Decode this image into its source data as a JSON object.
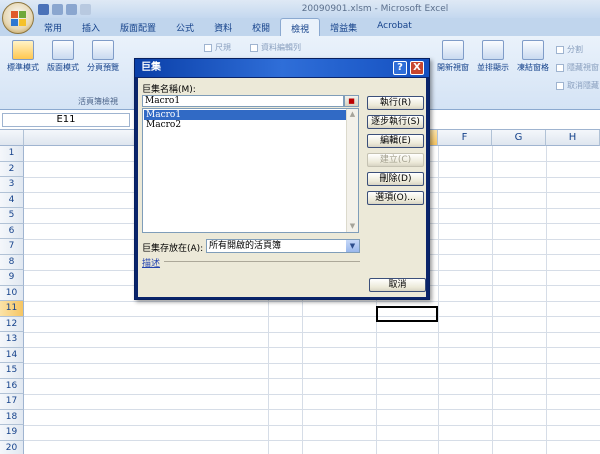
{
  "window": {
    "title": "20090901.xlsm - Microsoft Excel"
  },
  "ribbon_tabs": [
    "常用",
    "插入",
    "版面配置",
    "公式",
    "資料",
    "校閱",
    "檢視",
    "增益集",
    "Acrobat"
  ],
  "active_tab_index": 6,
  "ribbon": {
    "btn_normal": "標準模式",
    "btn_page_layout": "版面模式",
    "btn_page_break": "分頁預覽",
    "group_workbook_views": "活頁簿檢視",
    "check_ruler": "尺規",
    "check_formula_bar": "資料編輯列",
    "btn_new_window": "開新視窗",
    "btn_arrange": "並排顯示",
    "btn_freeze": "凍結窗格",
    "split": "分割",
    "hide": "隱藏視窗",
    "unhide": "取消隱藏"
  },
  "name_box": "E11",
  "columns": [
    "F",
    "G",
    "H"
  ],
  "rows": [
    "1",
    "2",
    "3",
    "4",
    "5",
    "6",
    "7",
    "8",
    "9",
    "10",
    "11",
    "12",
    "13",
    "14",
    "15",
    "16",
    "17",
    "18",
    "19",
    "20"
  ],
  "selected_row": "11",
  "dialog": {
    "title": "巨集",
    "help_glyph": "?",
    "close_glyph": "X",
    "macro_name_label": "巨集名稱(M):",
    "macro_name_value": "Macro1",
    "macros": [
      "Macro1",
      "Macro2"
    ],
    "selected_index": 0,
    "buttons": {
      "run": "執行(R)",
      "step_into": "逐步執行(S)",
      "edit": "編輯(E)",
      "create": "建立(C)",
      "delete": "刪除(D)",
      "options": "選項(O)...",
      "cancel": "取消"
    },
    "macros_in_label": "巨集存放在(A):",
    "macros_in_value": "所有開啟的活頁簿",
    "description_label": "描述"
  },
  "colors": {
    "title_gradient": "#0a3fa8",
    "selection": "#316ac5",
    "dialog_face": "#ece9d8",
    "ribbon_bg": "#dbe6f4",
    "header_highlight": "#f6c562"
  }
}
